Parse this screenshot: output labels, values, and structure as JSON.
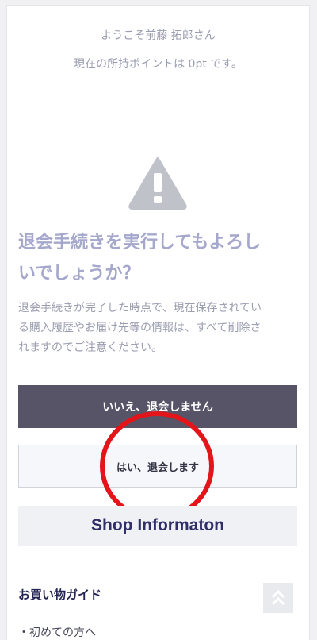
{
  "header": {
    "welcome": "ようこそ前藤 拓郎さん",
    "points": "現在の所持ポイントは 0pt です。"
  },
  "confirm": {
    "icon": "warning-triangle-icon",
    "heading_line1": "退会手続きを実行してもよろし",
    "heading_line2": "いでしょうか？",
    "note_line1": "退会手続きが完了した時点で、現在保存されてい",
    "note_line2": "る購入履歴やお届け先等の情報は、すべて削除さ",
    "note_line3": "れますのでご注意ください。",
    "cancel_label": "いいえ、退会しません",
    "confirm_label": "はい、退会します"
  },
  "footer": {
    "shop_title": "Shop Informaton",
    "guide_title": "お買い物ガイド",
    "guide_items": [
      "・初めての方へ"
    ],
    "scroll_top_icon": "double-chevron-up-icon"
  },
  "colors": {
    "accent_dark": "#575468",
    "heading": "#a5a8cc",
    "annotation_red": "#e4141b"
  }
}
